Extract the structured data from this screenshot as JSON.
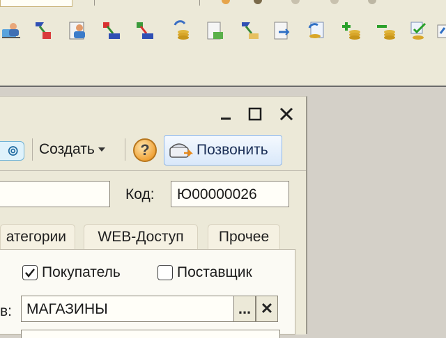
{
  "toolbar": {
    "icons": [
      "clients-icon",
      "exchange-doc-icon",
      "client-card-icon",
      "transfer-red-icon",
      "transfer-green-icon",
      "coins-refresh-icon",
      "document-coins-icon",
      "transfer-doc-icon",
      "document-exchange-icon",
      "refresh-coins-icon",
      "add-coins-icon",
      "remove-coins-icon",
      "check-coins-icon",
      "edit-icon"
    ]
  },
  "window": {
    "caption_buttons": [
      "minimize-icon",
      "maximize-icon",
      "close-icon"
    ],
    "toolbar": {
      "create_label": "Создать",
      "help_label": "?",
      "call_label": "Позвонить"
    },
    "form": {
      "name_value": "",
      "kod_label": "Код:",
      "kod_value": "Ю00000026",
      "tabs": [
        "атегории",
        "WEB-Доступ",
        "Прочее"
      ],
      "buyer_label": "Покупатель",
      "buyer_checked": true,
      "supplier_label": "Поставщик",
      "supplier_checked": false,
      "group_label": "в:",
      "group_value": "МАГАЗИНЫ",
      "select_label": "...",
      "clear_label": "✕"
    }
  },
  "colors": {
    "accent": "#8fb6e6",
    "background": "#ece9d8",
    "workspace": "#d4d0c8"
  }
}
